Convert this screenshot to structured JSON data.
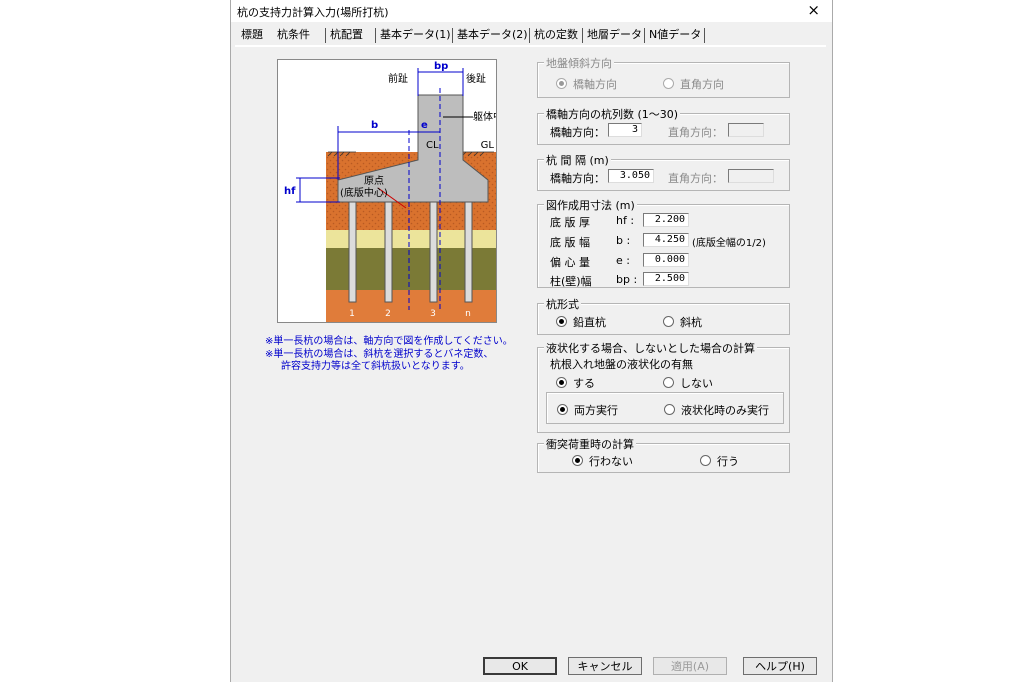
{
  "window": {
    "title": "杭の支持力計算入力(場所打杭)",
    "close": "×"
  },
  "tabs": [
    "標題",
    "杭条件",
    "杭配置",
    "基本データ(1)",
    "基本データ(2)",
    "杭の定数",
    "地層データ",
    "N値データ"
  ],
  "active_tab": "杭条件",
  "figure": {
    "labels": {
      "front": "前趾",
      "back": "後趾",
      "bp": "bp",
      "body_center": "躯体中心",
      "b": "b",
      "e": "e",
      "cl": "CL",
      "gl": "GL",
      "hf": "hf",
      "origin": "原点",
      "origin_sub": "(底版中心)"
    },
    "pile_numbers": [
      "1",
      "2",
      "3",
      "n"
    ],
    "colors": {
      "soil_top": "#d9722e",
      "soil_pattern": "#c75a1f",
      "layer_yellow": "#ece49b",
      "layer_olive": "#7b7a36",
      "layer_orange": "#e07c3a",
      "concrete": "#bdbdbd",
      "dim_blue": "#0000cc"
    }
  },
  "notes": [
    "※単一長杭の場合は、軸方向で図を作成してください。",
    "※単一長杭の場合は、斜杭を選択するとバネ定数、",
    "許容支持力等は全て斜杭扱いとなります。"
  ],
  "ground_slope": {
    "title": "地盤傾斜方向",
    "options": [
      "橋軸方向",
      "直角方向"
    ],
    "selected": "橋軸方向"
  },
  "pile_rows": {
    "title": "橋軸方向の杭列数 (1～30)",
    "axial_label": "橋軸方向：",
    "axial_value": "3",
    "perp_label": "直角方向：",
    "perp_value": ""
  },
  "pile_spacing": {
    "title": "杭 間 隔 (m)",
    "axial_label": "橋軸方向：",
    "axial_value": "3.050",
    "perp_label": "直角方向：",
    "perp_value": ""
  },
  "drawing_dims": {
    "title": "図作成用寸法 (m)",
    "rows": [
      {
        "label": "底 版 厚",
        "sym": "hf :",
        "value": "2.200",
        "note": ""
      },
      {
        "label": "底 版 幅",
        "sym": "b  :",
        "value": "4.250",
        "note": "(底版全幅の1/2)"
      },
      {
        "label": "偏 心 量",
        "sym": "e  :",
        "value": "0.000",
        "note": ""
      },
      {
        "label": "柱(壁)幅",
        "sym": "bp :",
        "value": "2.500",
        "note": ""
      }
    ]
  },
  "pile_type": {
    "title": "杭形式",
    "options": [
      "鉛直杭",
      "斜杭"
    ],
    "selected": "鉛直杭"
  },
  "liquefaction": {
    "title": "液状化する場合、しないとした場合の計算",
    "question": "杭根入れ地盤の液状化の有無",
    "options": [
      "する",
      "しない"
    ],
    "selected": "する",
    "mode_options": [
      "両方実行",
      "液状化時のみ実行"
    ],
    "mode_selected": "両方実行"
  },
  "impact": {
    "title": "衝突荷重時の計算",
    "options": [
      "行わない",
      "行う"
    ],
    "selected": "行わない"
  },
  "buttons": {
    "ok": "OK",
    "cancel": "キャンセル",
    "apply": "適用(A)",
    "help": "ヘルプ(H)"
  }
}
